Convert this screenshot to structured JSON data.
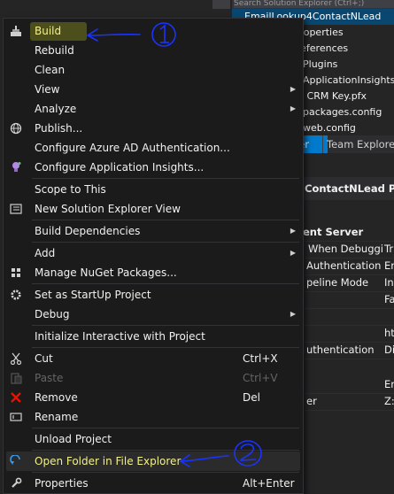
{
  "background": {
    "search_placeholder": "Search Solution Explorer (Ctrl+;)",
    "tree": [
      "EmailLookup4ContactNLead",
      "Properties",
      "References",
      "Plugins",
      "ApplicationInsights.config",
      "' CRM Key.pfx",
      "packages.config",
      "web.config"
    ],
    "tabs": [
      "ler",
      "Team Explorer"
    ],
    "properties_title": "ContactNLead  Pro",
    "properties": [
      {
        "name": "ent Server",
        "value": ""
      },
      {
        "name": "When Debuggi",
        "value": "Tr"
      },
      {
        "name": "Authentication",
        "value": "Er"
      },
      {
        "name": "peline Mode",
        "value": "In"
      },
      {
        "name": "",
        "value": "Fa"
      },
      {
        "name": "",
        "value": ""
      },
      {
        "name": "",
        "value": "ht"
      },
      {
        "name": "",
        "value": "ht"
      },
      {
        "name": "uthentication",
        "value": "Di"
      },
      {
        "name": "",
        "value": ""
      },
      {
        "name": "",
        "value": "En"
      },
      {
        "name": "er",
        "value": "Z:"
      }
    ]
  },
  "menu": {
    "items": [
      {
        "label": "Build",
        "icon": "build-icon",
        "highlight": true
      },
      {
        "label": "Rebuild"
      },
      {
        "label": "Clean"
      },
      {
        "label": "View",
        "submenu": true
      },
      {
        "label": "Analyze",
        "submenu": true
      },
      {
        "label": "Publish...",
        "icon": "globe-icon"
      },
      {
        "label": "Configure Azure AD Authentication..."
      },
      {
        "label": "Configure Application Insights...",
        "icon": "insights-icon"
      },
      {
        "label": "Scope to This"
      },
      {
        "label": "New Solution Explorer View",
        "icon": "new-view-icon"
      },
      {
        "label": "Build Dependencies",
        "submenu": true
      },
      {
        "label": "Add",
        "submenu": true
      },
      {
        "label": "Manage NuGet Packages...",
        "icon": "nuget-icon"
      },
      {
        "label": "Set as StartUp Project",
        "icon": "gear-icon"
      },
      {
        "label": "Debug",
        "submenu": true
      },
      {
        "label": "Initialize Interactive with Project"
      },
      {
        "label": "Cut",
        "icon": "scissors-icon",
        "shortcut": "Ctrl+X"
      },
      {
        "label": "Paste",
        "icon": "paste-icon",
        "shortcut": "Ctrl+V",
        "disabled": true
      },
      {
        "label": "Remove",
        "icon": "remove-icon",
        "shortcut": "Del"
      },
      {
        "label": "Rename",
        "icon": "rename-icon"
      },
      {
        "label": "Unload Project"
      },
      {
        "label": "Open Folder in File Explorer",
        "icon": "open-folder-icon",
        "highlight": true
      },
      {
        "label": "Properties",
        "icon": "wrench-icon",
        "shortcut": "Alt+Enter"
      }
    ]
  },
  "annotations": {
    "ink_color": "#1a33ff",
    "highlight_color": "#cdd61e"
  }
}
